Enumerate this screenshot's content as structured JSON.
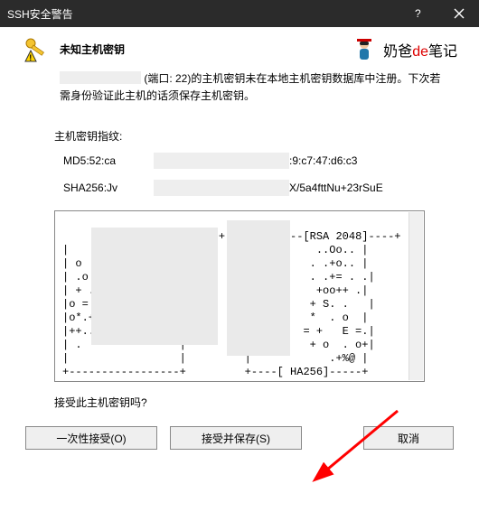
{
  "titlebar": {
    "title": "SSH安全警告"
  },
  "header": {
    "title": "未知主机密钥"
  },
  "logo": {
    "prefix": "奶爸",
    "mid": "de",
    "suffix": "笔记"
  },
  "message": {
    "line1_suffix": "(端口: 22)的主机密钥未在本地主机密钥数据库中注册。下次若需身份验证此主机的话须保存主机密钥。"
  },
  "fingerprint": {
    "label": "主机密钥指纹:",
    "md5_label": "MD5:52:ca",
    "md5_tail": ":9:c7:47:d6:c3",
    "sha_label": "SHA256:Jv",
    "sha_tail": "X/5a4fttNu+23rSuE"
  },
  "ascii": {
    "text": "+---[RSA 2048]----+        +---[RSA 2048]----+\n|                 |         |          ..Oo.. |\n| o               |         |         . .+o.. |\n| .o .            |         |         . .+= . .|\n| + .             |         |          +oo++ .|\n|o = o            |         |         + S. .   |\n|o*.+ o           |         |         *  . o  |\n|++..+.           |         |        = +   E =.|\n| .               |         |         + o  . o+|\n|                 |         |            .+%@ |\n+-----------------+         +----[ HA256]-----+"
  },
  "question": "接受此主机密钥吗?",
  "buttons": {
    "accept_once": "一次性接受(O)",
    "accept_save": "接受并保存(S)",
    "cancel": "取消"
  }
}
